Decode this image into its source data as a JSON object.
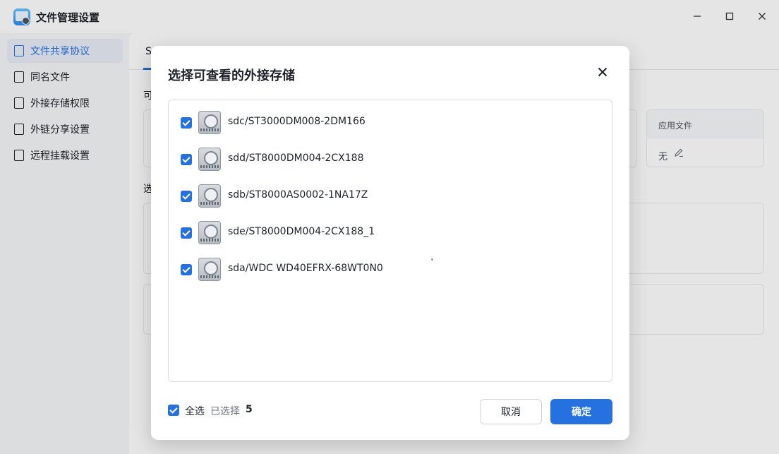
{
  "window": {
    "title": "文件管理设置",
    "minimize_icon": "minimize-icon",
    "maximize_icon": "maximize-icon",
    "close_icon": "close-icon"
  },
  "sidebar": {
    "items": [
      {
        "label": "文件共享协议",
        "icon": "document-icon",
        "active": true
      },
      {
        "label": "同名文件",
        "icon": "file-icon",
        "active": false
      },
      {
        "label": "外接存储权限",
        "icon": "drive-icon",
        "active": false
      },
      {
        "label": "外链分享设置",
        "icon": "share-icon",
        "active": false
      },
      {
        "label": "远程挂载设置",
        "icon": "folder-icon",
        "active": false
      }
    ]
  },
  "main": {
    "tab_fragment": "S",
    "section_fragments": [
      "可",
      "选"
    ],
    "apply_file_header": "应用文件",
    "apply_file_value": "无"
  },
  "dialog": {
    "title": "选择可查看的外接存储",
    "drives": [
      {
        "name": "sdc/ST3000DM008-2DM166",
        "checked": true
      },
      {
        "name": "sdd/ST8000DM004-2CX188",
        "checked": true
      },
      {
        "name": "sdb/ST8000AS0002-1NA17Z",
        "checked": true
      },
      {
        "name": "sde/ST8000DM004-2CX188_1",
        "checked": true
      },
      {
        "name": "sda/WDC WD40EFRX-68WT0N0",
        "checked": true
      }
    ],
    "select_all_label": "全选",
    "selected_label": "已选择",
    "selected_count": "5",
    "cancel_label": "取消",
    "ok_label": "确定"
  },
  "colors": {
    "accent": "#2671e0",
    "active_bg": "#e8edf7"
  }
}
